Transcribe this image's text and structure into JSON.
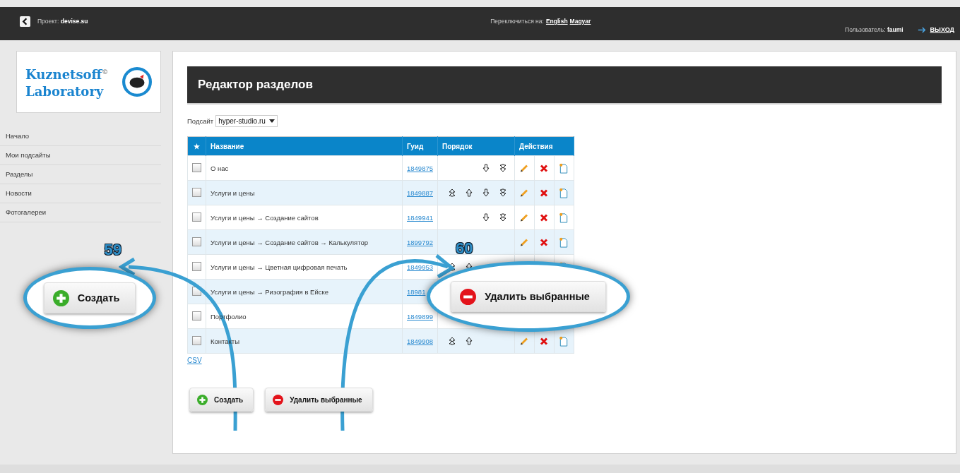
{
  "top_bar": {
    "project": "Проект: **devise.su**",
    "language_label": "Переключиться на:",
    "languages": [
      "English",
      "Magyar"
    ],
    "user": "Пользователь: **faumi**",
    "logout": "ВЫХОД"
  },
  "logo": {
    "line1": "Kuznetsoff$^{©}$",
    "line2": "Laboratory"
  },
  "sidebar": {
    "items": [
      {
        "label": "Начало"
      },
      {
        "label": "Мои подсайты"
      },
      {
        "label": "Разделы"
      },
      {
        "label": "Новости"
      },
      {
        "label": "Фотогалереи"
      }
    ]
  },
  "page_title": "Редактор разделов",
  "subsite": {
    "label": "Подсайт",
    "value": "hyper-studio.ru"
  },
  "table": {
    "columns": [
      "★",
      "Название",
      "Гуид",
      "Порядок",
      "Действия"
    ],
    "rows": [
      {
        "checked": false,
        "name": "О нас",
        "guid": "1849875",
        "order": {
          "top": false,
          "up": false,
          "down": true,
          "bottom": true
        },
        "actions": {
          "edit": true,
          "delete": true,
          "page": true
        }
      },
      {
        "checked": false,
        "name": "Услуги и цены",
        "guid": "1849887",
        "order": {
          "top": true,
          "up": true,
          "down": true,
          "bottom": true
        },
        "actions": {
          "edit": true,
          "delete": true,
          "page": true
        }
      },
      {
        "checked": false,
        "name": "Услуги и цены → Создание сайтов",
        "guid": "1849941",
        "order": {
          "top": false,
          "up": false,
          "down": true,
          "bottom": true
        },
        "actions": {
          "edit": true,
          "delete": true,
          "page": true
        }
      },
      {
        "checked": false,
        "name": "Услуги и цены → Создание сайтов → Калькулятор",
        "guid": "1899792",
        "order": {
          "top": false,
          "up": false,
          "down": false,
          "bottom": false
        },
        "actions": {
          "edit": true,
          "delete": true,
          "page": true
        }
      },
      {
        "checked": false,
        "name": "Услуги и цены → Цветная цифровая печать",
        "guid": "1849953",
        "order": {
          "top": true,
          "up": true
        },
        "actions": {
          "page": true
        }
      },
      {
        "checked": false,
        "name": "Услуги и цены → Ризография в Ейске",
        "guid": "18981"
      },
      {
        "checked": false,
        "name": "Портфолио",
        "guid": "1849899"
      },
      {
        "checked": false,
        "name": "Контакты",
        "guid": "1849908",
        "order": {
          "top": true,
          "up": true,
          "down": false,
          "bottom": false
        },
        "actions": {
          "edit": true,
          "delete": true,
          "page": true
        }
      }
    ]
  },
  "csv_link": "CSV",
  "buttons": [
    {
      "kind": "create",
      "label": "Создать"
    },
    {
      "kind": "delete",
      "label": "Удалить выбранные"
    }
  ],
  "callouts": [
    {
      "kind": "create",
      "number": "59",
      "label": "Создать"
    },
    {
      "kind": "delete",
      "number": "60",
      "label": "Удалить выбранные"
    }
  ]
}
